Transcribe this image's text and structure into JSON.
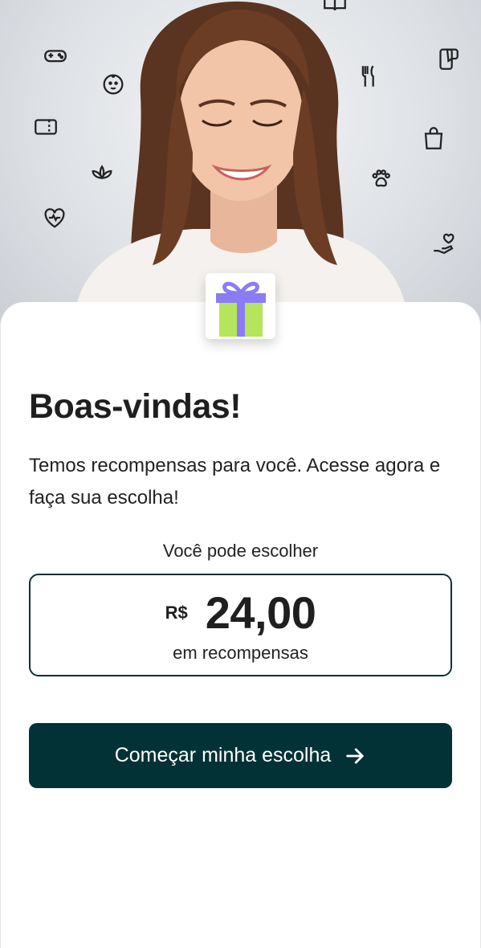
{
  "hero": {
    "photo": "smiling-woman-photo",
    "doodles": [
      "gamepad-icon",
      "baby-face-icon",
      "ticket-icon",
      "lotus-icon",
      "heart-pulse-icon",
      "cutlery-icon",
      "phone-chat-icon",
      "shopping-bag-icon",
      "paw-icon",
      "hand-heart-icon",
      "book-icon"
    ]
  },
  "gift_icon": "gift-icon",
  "title": "Boas-vindas!",
  "subtitle": "Temos recompensas para você. Acesse agora e faça sua escolha!",
  "reward": {
    "label": "Você pode escolher",
    "currency": "R$",
    "amount": "24,00",
    "caption": "em recompensas"
  },
  "cta": {
    "label": "Começar minha escolha",
    "icon": "arrow-right-icon"
  },
  "colors": {
    "primary": "#033236",
    "gift_lid": "#8b7cf6",
    "gift_body": "#b5e55a",
    "text": "#1f1f1f"
  }
}
